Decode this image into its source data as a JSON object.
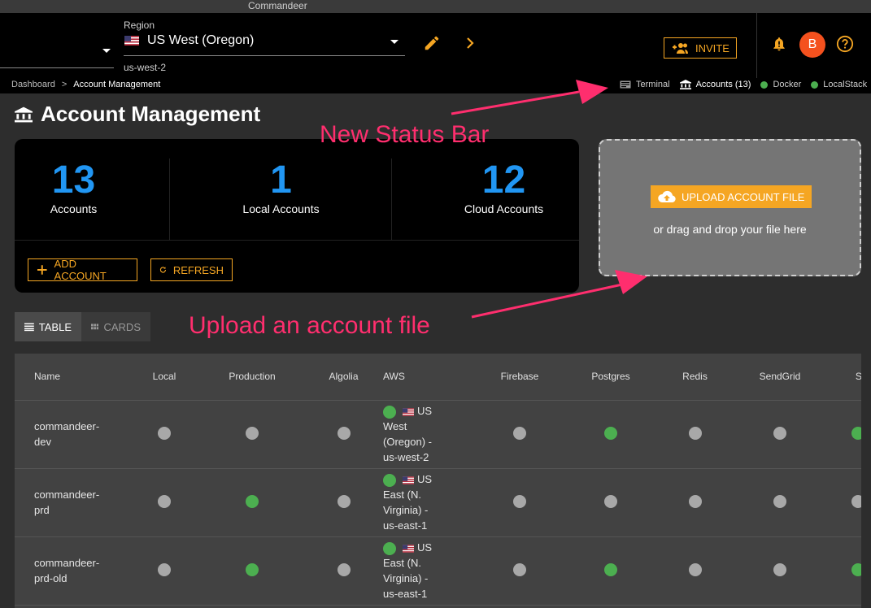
{
  "app": {
    "title": "Commandeer"
  },
  "region": {
    "label": "Region",
    "value": "US West (Oregon)",
    "code": "us-west-2"
  },
  "header": {
    "invite_label": "INVITE",
    "avatar_initial": "B"
  },
  "breadcrumb": {
    "root": "Dashboard",
    "separator": ">",
    "current": "Account Management"
  },
  "status_bar": {
    "terminal": "Terminal",
    "accounts": "Accounts (13)",
    "docker": "Docker",
    "localstack": "LocalStack"
  },
  "page": {
    "title": "Account Management"
  },
  "stats": [
    {
      "value": "13",
      "label": "Accounts"
    },
    {
      "value": "1",
      "label": "Local Accounts"
    },
    {
      "value": "12",
      "label": "Cloud Accounts"
    }
  ],
  "actions": {
    "add_account": "ADD ACCOUNT",
    "refresh": "REFRESH"
  },
  "upload": {
    "button": "UPLOAD ACCOUNT FILE",
    "hint": "or drag and drop your file here"
  },
  "annotations": {
    "status_bar": "New Status Bar",
    "upload": "Upload an account file"
  },
  "view_toggle": {
    "table": "TABLE",
    "cards": "CARDS"
  },
  "table": {
    "columns": [
      "Name",
      "Local",
      "Production",
      "Algolia",
      "AWS",
      "Firebase",
      "Postgres",
      "Redis",
      "SendGrid",
      "SI"
    ],
    "rows": [
      {
        "name_line1": "commandeer-",
        "name_line2": "dev",
        "local": "grey",
        "production": "grey",
        "algolia": "grey",
        "aws_line1": "US",
        "aws_line2": "West",
        "aws_line3": "(Oregon) -",
        "aws_line4": "us-west-2",
        "firebase": "grey",
        "postgres": "green",
        "redis": "grey",
        "sendgrid": "grey",
        "si": "green"
      },
      {
        "name_line1": "commandeer-",
        "name_line2": "prd",
        "local": "grey",
        "production": "green",
        "algolia": "grey",
        "aws_line1": "US",
        "aws_line2": "East (N.",
        "aws_line3": "Virginia) -",
        "aws_line4": "us-east-1",
        "firebase": "grey",
        "postgres": "grey",
        "redis": "grey",
        "sendgrid": "grey",
        "si": "grey"
      },
      {
        "name_line1": "commandeer-",
        "name_line2": "prd-old",
        "local": "grey",
        "production": "green",
        "algolia": "grey",
        "aws_line1": "US",
        "aws_line2": "East (N.",
        "aws_line3": "Virginia) -",
        "aws_line4": "us-east-1",
        "firebase": "grey",
        "postgres": "green",
        "redis": "grey",
        "sendgrid": "grey",
        "si": "green"
      }
    ]
  },
  "colors": {
    "accent": "#f5a623",
    "stat_number": "#2196f3",
    "status_green": "#4caf50",
    "status_grey": "#a8a8a8",
    "annotation": "#ff2e6e",
    "avatar": "#f4511e"
  }
}
